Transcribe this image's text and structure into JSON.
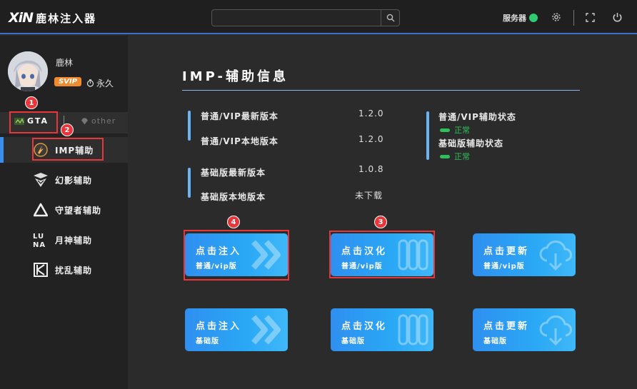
{
  "app": {
    "logo_mark": "XiN",
    "title": "鹿林注入器",
    "server_label": "服务器",
    "server_status_color": "#2ecc71"
  },
  "search": {
    "placeholder": "",
    "value": ""
  },
  "user": {
    "name": "鹿林",
    "badge": "SVIP",
    "duration": "永久"
  },
  "game_tabs": [
    {
      "label": "GTA",
      "active": true
    },
    {
      "label": "other",
      "active": false
    }
  ],
  "menu": [
    {
      "label": "IMP辅助",
      "icon": "imp-icon",
      "active": true
    },
    {
      "label": "幻影辅助",
      "icon": "phantom-icon",
      "active": false
    },
    {
      "label": "守望者辅助",
      "icon": "watcher-icon",
      "active": false
    },
    {
      "label": "月神辅助",
      "icon": "luna-icon",
      "active": false
    },
    {
      "label": "扰乱辅助",
      "icon": "disrupt-icon",
      "active": false
    }
  ],
  "main": {
    "title": "IMP-辅助信息",
    "info": [
      {
        "label": "普通/VIP最新版本",
        "value": "1.2.0"
      },
      {
        "label": "普通/VIP本地版本",
        "value": "1.2.0"
      },
      {
        "label": "基础版最新版本",
        "value": "1.0.8"
      },
      {
        "label": "基础版本地版本",
        "value": "未下载"
      }
    ],
    "status": [
      {
        "label": "普通/VIP辅助状态",
        "value": "正常"
      },
      {
        "label": "基础版辅助状态",
        "value": "正常"
      }
    ],
    "status_color": "#2fbf5a",
    "accent": "#3a8ef0"
  },
  "actions": [
    {
      "title": "点击注入",
      "sub": "普通/vip版",
      "icon": "double-chevron-icon"
    },
    {
      "title": "点击汉化",
      "sub": "普通/vip版",
      "icon": "book-icon"
    },
    {
      "title": "点击更新",
      "sub": "普通/vip版",
      "icon": "cloud-download-icon"
    },
    {
      "title": "点击注入",
      "sub": "基础版",
      "icon": "double-chevron-icon"
    },
    {
      "title": "点击汉化",
      "sub": "基础版",
      "icon": "book-icon"
    },
    {
      "title": "点击更新",
      "sub": "基础版",
      "icon": "cloud-download-icon"
    }
  ],
  "annotations": [
    "1",
    "2",
    "3",
    "4"
  ],
  "annotation_color": "#e8363b"
}
